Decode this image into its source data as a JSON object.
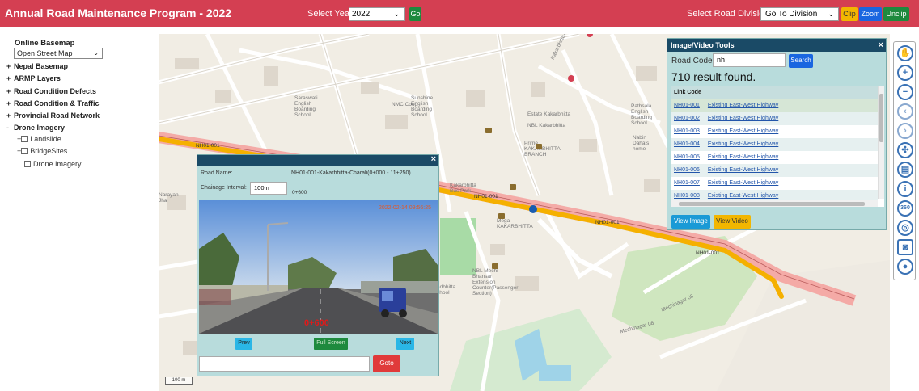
{
  "header": {
    "title": "Annual Road Maintenance Program - 2022",
    "year_label": "Select Year:",
    "year_value": "2022",
    "go_label": "Go",
    "division_label": "Select Road Division:",
    "division_value": "Go To Division",
    "clip_label": "Clip",
    "zoom_label": "Zoom",
    "unclip_label": "Unclip",
    "accent_color": "#d43f52"
  },
  "sidebar": {
    "basemap_title": "Online Basemap",
    "basemap_value": "Open Street Map",
    "layers": [
      {
        "toggle": "+",
        "label": "Nepal Basemap"
      },
      {
        "toggle": "+",
        "label": "ARMP Layers"
      },
      {
        "toggle": "+",
        "label": "Road Condition Defects"
      },
      {
        "toggle": "+",
        "label": "Road Condition & Traffic"
      },
      {
        "toggle": "+",
        "label": "Provincial Road Network"
      },
      {
        "toggle": "-",
        "label": "Drone Imagery"
      }
    ],
    "drone_items": [
      {
        "toggle": "+",
        "label": "Landslide"
      },
      {
        "toggle": "+",
        "label": "BridgeSites"
      },
      {
        "toggle": "",
        "label": "Drone Imagery"
      }
    ]
  },
  "map": {
    "labels": [
      "NH01-001",
      "NH01-001",
      "NH01-001",
      "NH01-001",
      "NMC Coop",
      "Saraswati English Boarding School",
      "Sunshine English Boarding School",
      "Pathsala English Boarding School",
      "Nabin Dahals home",
      "Kakarbhitta Bus Park",
      "Prime KAKARBHITTA BRANCH",
      "Mega KAKARBHITTA",
      "NBL Mechi Bhansar Extension Counter(Passenger Section)",
      "Kakarbhitta-Bahundangi",
      "Mechinagar 08",
      "Mechinagar 08",
      "Narayan Jha",
      "Estate Kakarbhitta",
      "NBL Kakarbhitta",
      "adbhitta chool"
    ],
    "scale_label": "100 m",
    "route_color": "#f5b000",
    "route_highlight_color": "#f4a3a0"
  },
  "toolbar": {
    "tools": [
      {
        "icon": "pan-hand-icon",
        "glyph": "✋"
      },
      {
        "icon": "zoom-in-icon",
        "glyph": "+"
      },
      {
        "icon": "zoom-out-icon",
        "glyph": "−"
      },
      {
        "icon": "back-arrow-icon",
        "glyph": "‹"
      },
      {
        "icon": "forward-arrow-icon",
        "glyph": "›"
      },
      {
        "icon": "full-extent-icon",
        "glyph": "✣"
      },
      {
        "icon": "print-icon",
        "glyph": "▤"
      },
      {
        "icon": "info-icon",
        "glyph": "i"
      },
      {
        "icon": "360-view-icon",
        "glyph": "360"
      },
      {
        "icon": "globe-icon",
        "glyph": "◎"
      },
      {
        "icon": "camera-icon",
        "glyph": "◙"
      },
      {
        "icon": "location-icon",
        "glyph": "●"
      }
    ]
  },
  "image_video_tools": {
    "title": "Image/Video Tools",
    "close_glyph": "×",
    "road_code_label": "Road Code:",
    "road_code_value": "nh",
    "search_label": "Search",
    "result_count": "710 result found.",
    "table_header": "Link Code",
    "rows": [
      {
        "code": "NH01-001",
        "name": "Existing East-West Highway"
      },
      {
        "code": "NH01-002",
        "name": "Existing East-West Highway"
      },
      {
        "code": "NH01-003",
        "name": "Existing East-West Highway"
      },
      {
        "code": "NH01-004",
        "name": "Existing East-West Highway"
      },
      {
        "code": "NH01-005",
        "name": "Existing East-West Highway"
      },
      {
        "code": "NH01-006",
        "name": "Existing East-West Highway"
      },
      {
        "code": "NH01-007",
        "name": "Existing East-West Highway"
      },
      {
        "code": "NH01-008",
        "name": "Existing East-West Highway"
      }
    ],
    "view_image_label": "View Image",
    "view_video_label": "View Video"
  },
  "video_viewer": {
    "close_glyph": "×",
    "road_name_label": "Road Name:",
    "road_name_value": "NH01-001-Kakarbhitta-Charali(0+000 - 11+250)",
    "chainage_label": "Chainage Interval:",
    "chainage_interval_value": "100m",
    "chainage_value": "0+600",
    "video_timestamp": "2022-02-14 09:56:25",
    "video_chainage_overlay": "0+600",
    "prev_label": "Prev",
    "fullscreen_label": "Full Screen",
    "next_label": "Next",
    "goto_value": "",
    "goto_label": "Goto"
  }
}
